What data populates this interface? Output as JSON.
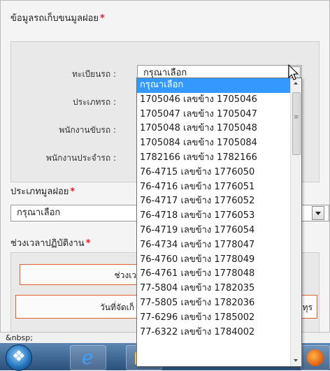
{
  "form": {
    "section_vehicle_title": "ข้อมูลรถเก็บขนมูลฝอย",
    "required_mark": "*",
    "fields": {
      "vehicle_reg_label": "ทะเบียนรถ :",
      "vehicle_reg_value": "กรุณาเลือก",
      "vehicle_type_label": "ประเภทรถ :",
      "driver_label": "พนักงานขับรถ :",
      "crew_label": "พนักงานประจำรถ :"
    },
    "section_waste_type_title": "ประเภทมูลฝอย",
    "waste_type_value": "กรุณาเลือก",
    "section_period_title": "ช่วงเวลาปฏิบัติงาน",
    "period_label": "ช่วงเวลา :",
    "collect_date_label": "วันที่จัดเก็",
    "partial_text_right": "ทุร"
  },
  "dropdown": {
    "options": [
      "กรุณาเลือก",
      "1705046 เลขข้าง 1705046",
      "1705047 เลขข้าง 1705047",
      "1705048 เลขข้าง 1705048",
      "1705084 เลขข้าง 1705084",
      "1782166 เลขข้าง 1782166",
      "76-4715 เลขข้าง 1776050",
      "76-4716 เลขข้าง 1776051",
      "76-4717 เลขข้าง 1776052",
      "76-4718 เลขข้าง 1776053",
      "76-4719 เลขข้าง 1776054",
      "76-4734 เลขข้าง 1778047",
      "76-4760 เลขข้าง 1778049",
      "76-4761 เลขข้าง 1778048",
      "77-5804 เลขข้าง 1782035",
      "77-5805 เลขข้าง 1782036",
      "77-6296 เลขข้าง 1785002",
      "77-6322 เลขข้าง 1784002"
    ],
    "selected_index": 0
  },
  "statusbar": {
    "text": "&nbsp;"
  },
  "taskbar": {
    "icons": [
      "windows-start-icon",
      "internet-explorer-icon",
      "folder-icon",
      "firefox-icon"
    ]
  },
  "colors": {
    "required": "#e02020",
    "selection": "#3399ff",
    "accent_border": "#e06030"
  }
}
